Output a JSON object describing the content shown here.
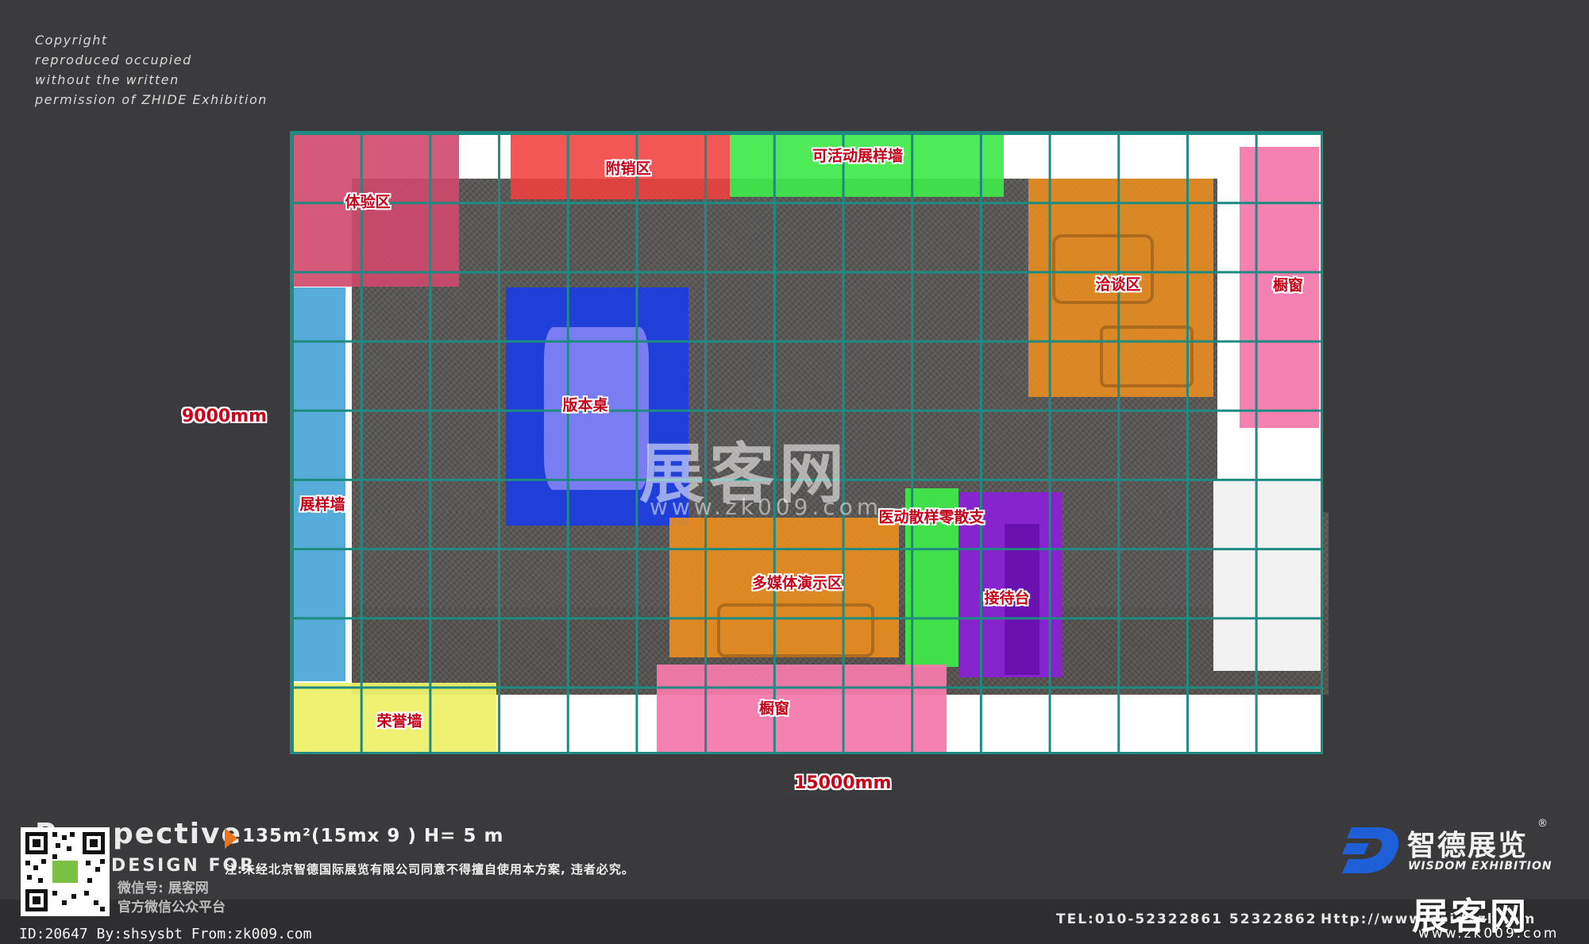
{
  "copyright": {
    "lines": [
      "Copyright",
      "reproduced occupied",
      "without the written",
      "permission of ZHIDE Exhibition"
    ]
  },
  "dimensions": {
    "height": "9000mm",
    "width": "15000mm"
  },
  "zones": {
    "experience": {
      "label": "体验区",
      "color": "#d0486c"
    },
    "sales": {
      "label": "附销区",
      "color": "#f0403f"
    },
    "movable_wall": {
      "label": "可活动展样墙",
      "color": "#3fe84a"
    },
    "negotiation": {
      "label": "洽谈区",
      "color": "#f0901c"
    },
    "window_right": {
      "label": "橱窗",
      "color": "#f47aac"
    },
    "sample_table": {
      "label": "版本桌",
      "color": "#1a3de8"
    },
    "sample_wall": {
      "label": "展样墙",
      "color": "#4fa8d8"
    },
    "multimedia": {
      "label": "多媒体演示区",
      "color": "#f0901c"
    },
    "partition": {
      "label": "医动散样零散支",
      "color": "#3fe84a"
    },
    "reception": {
      "label": "接待台",
      "color": "#8a1fd8"
    },
    "honor_wall": {
      "label": "荣誉墙",
      "color": "#eef06a"
    },
    "window_bottom": {
      "label": "橱窗",
      "color": "#f47aac"
    }
  },
  "watermark": {
    "text": "展客网",
    "url": "www.zk009.com"
  },
  "footer": {
    "title": "Perspective",
    "design_for": "DESIGN FOR",
    "spec": "135m²(15mx 9 ) H= 5 m",
    "note": "注:未经北京智德国际展览有限公司同意不得擅自使用本方案, 违者必究。",
    "wechat_line1": "微信号: 展客网",
    "wechat_line2": "官方微信公众平台",
    "brand_name": "智德展览",
    "brand_sub": "WISDOM EXHIBITION",
    "registered": "®",
    "tel": "TEL:010-52322861  52322862",
    "http": "Http://www.zhidezl.com",
    "id_line": "ID:20647 By:shsysbt From:zk009.com",
    "site_mark": "展客网",
    "site_mark_url": "www.zk009.com"
  }
}
